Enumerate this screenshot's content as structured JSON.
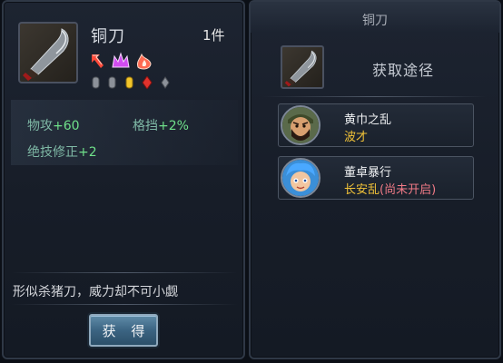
{
  "item": {
    "name": "铜刀",
    "count": "1件",
    "stats": [
      {
        "label": "物攻",
        "value": "+60"
      },
      {
        "label": "格挡",
        "value": "+2%"
      },
      {
        "label": "绝技修正",
        "value": "+2"
      }
    ],
    "description": "形似杀猪刀，威力却不可小觑",
    "obtain_button": "获 得"
  },
  "source_panel": {
    "title": "铜刀",
    "heading": "获取途径",
    "sources": [
      {
        "name": "黄巾之乱",
        "stage": "波才",
        "status": ""
      },
      {
        "name": "董卓暴行",
        "stage": "长安乱",
        "status": "(尚未开启)"
      }
    ]
  },
  "icons": [
    "sabre-icon",
    "arrow-icon",
    "crown-icon",
    "flame-icon"
  ],
  "colors": {
    "stat_label": "#7fb9a6",
    "stat_value": "#6fe08a",
    "stage_text": "#f2c338",
    "locked_text": "#f07a86"
  }
}
